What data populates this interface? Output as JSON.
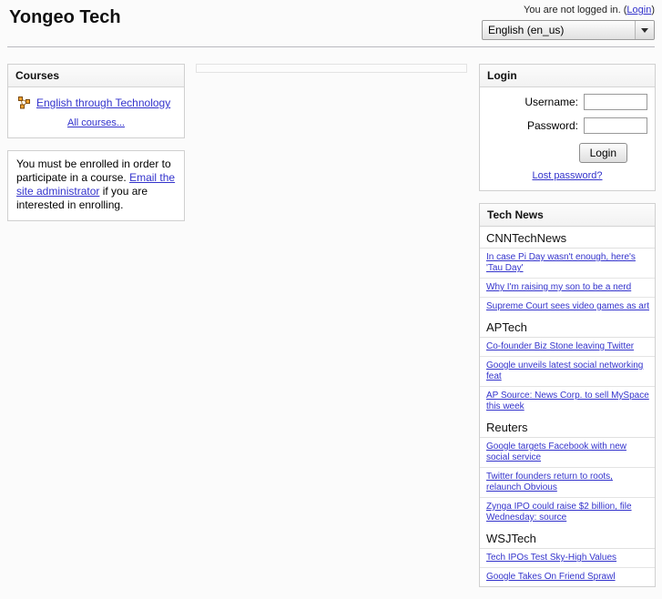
{
  "header": {
    "site_title": "Yongeo Tech",
    "login_status_text": "You are not logged in. (",
    "login_link": "Login",
    "login_status_suffix": ")",
    "language_selected": "English (en_us)"
  },
  "courses_block": {
    "title": "Courses",
    "items": [
      {
        "label": "English through Technology",
        "icon": "course-icon"
      }
    ],
    "all_courses_label": "All courses..."
  },
  "notice_block": {
    "text_part1": "You must be enrolled in order to participate in a course. ",
    "link_text": "Email the site administrator",
    "text_part2": " if you are interested in enrolling."
  },
  "login_block": {
    "title": "Login",
    "username_label": "Username:",
    "username_value": "",
    "password_label": "Password:",
    "password_value": "",
    "login_button_label": "Login",
    "lost_password_label": "Lost password?"
  },
  "news_block": {
    "title": "Tech News",
    "feeds": [
      {
        "name": "CNNTechNews",
        "items": [
          "In case Pi Day wasn't enough, here's 'Tau Day'",
          "Why I'm raising my son to be a nerd",
          "Supreme Court sees video games as art"
        ]
      },
      {
        "name": "APTech",
        "items": [
          "Co-founder Biz Stone leaving Twitter",
          "Google unveils latest social networking feat",
          "AP Source: News Corp. to sell MySpace this week"
        ]
      },
      {
        "name": "Reuters",
        "items": [
          "Google targets Facebook with new social service",
          "Twitter founders return to roots, relaunch Obvious",
          "Zynga IPO could raise $2 billion, file Wednesday: source"
        ]
      },
      {
        "name": "WSJTech",
        "items": [
          "Tech IPOs Test Sky-High Values",
          "Google Takes On Friend Sprawl"
        ]
      }
    ]
  },
  "colors": {
    "link": "#3333cc",
    "page_bg": "#fbfbfb",
    "block_border": "#d0d0d0"
  }
}
